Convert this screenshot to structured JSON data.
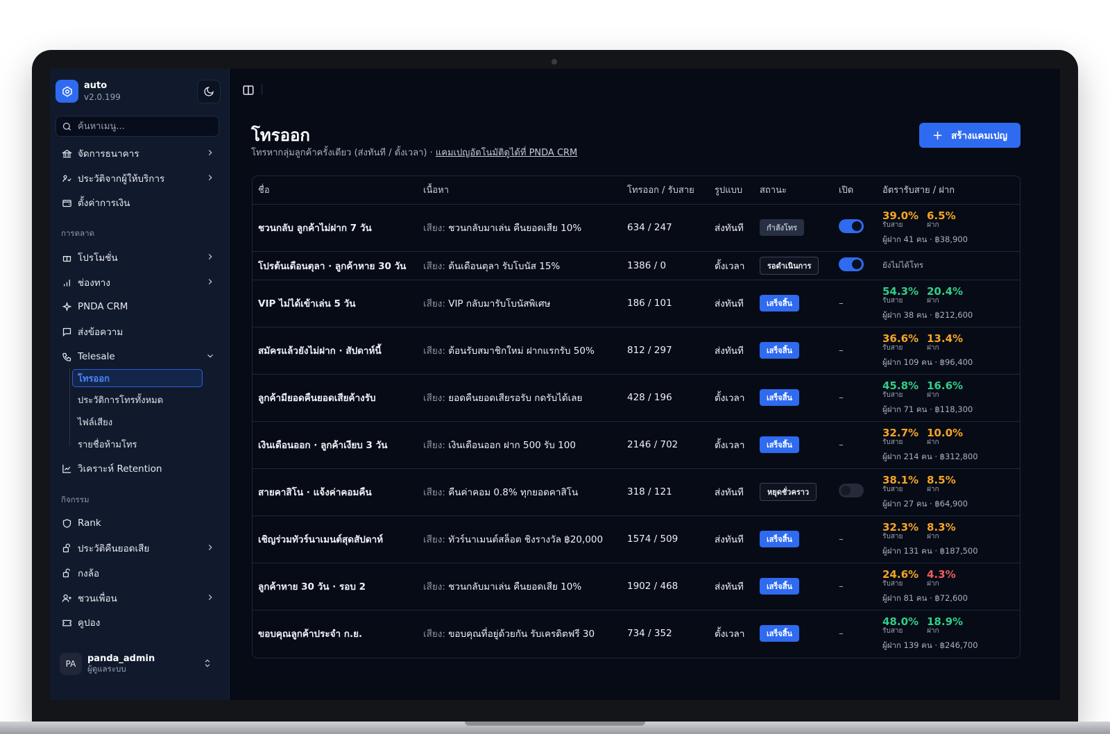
{
  "app": {
    "name": "auto",
    "version": "v2.0.199"
  },
  "search": {
    "placeholder": "ค้นหาเมนู..."
  },
  "sidebar": {
    "top_items": [
      {
        "label": "จัดการธนาคาร",
        "icon": "bank-icon"
      },
      {
        "label": "ประวัติจากผู้ให้บริการ",
        "icon": "provider-icon"
      },
      {
        "label": "ตั้งค่าการเงิน",
        "icon": "wallet-icon"
      }
    ],
    "section_marketing": "การตลาด",
    "marketing_items": [
      {
        "label": "โปรโมชั่น",
        "icon": "gift-icon"
      },
      {
        "label": "ช่องทาง",
        "icon": "bar-chart-icon"
      },
      {
        "label": "PNDA CRM",
        "icon": "sparkle-icon"
      },
      {
        "label": "ส่งข้อความ",
        "icon": "message-icon"
      },
      {
        "label": "Telesale",
        "icon": "phone-icon"
      }
    ],
    "telesale_sub": [
      "โทรออก",
      "ประวัติการโทรทั้งหมด",
      "ไฟล์เสียง",
      "รายชื่อห้ามโทร"
    ],
    "retention": "วิเคราะห์ Retention",
    "section_activity": "กิจกรรม",
    "activity_items": [
      {
        "label": "Rank",
        "icon": "shield-icon"
      },
      {
        "label": "ประวัติคืนยอดเสีย",
        "icon": "refund-icon"
      },
      {
        "label": "กงล้อ",
        "icon": "wheel-icon"
      },
      {
        "label": "ชวนเพื่อน",
        "icon": "user-plus-icon"
      },
      {
        "label": "คูปอง",
        "icon": "ticket-icon"
      }
    ],
    "user": {
      "initials": "PA",
      "name": "panda_admin",
      "role": "ผู้ดูแลระบบ"
    }
  },
  "page": {
    "title": "โทรออก",
    "subtitle": "โทรหากลุ่มลูกค้าครั้งเดียว (ส่งทันที / ตั้งเวลา) ·",
    "subtitle_link": "แคมเปญอัตโนมัติดูได้ที่ PNDA CRM",
    "create_button": "สร้างแคมเปญ"
  },
  "table": {
    "headers": [
      "ชื่อ",
      "เนื้อหา",
      "โทรออก / รับสาย",
      "รูปแบบ",
      "สถานะ",
      "เปิด",
      "อัตรารับสาย / ฝาก"
    ],
    "voice_prefix": "เสียง:",
    "answer_label": "รับสาย",
    "deposit_label": "ฝาก",
    "rows": [
      {
        "name": "ชวนกลับ ลูกค้าไม่ฝาก 7 วัน",
        "content": "ชวนกลับมาเล่น คืนยอดเสีย 10%",
        "calls": "634 / 247",
        "mode": "ส่งทันที",
        "status": "กำลังโทร",
        "status_type": "calling",
        "toggle": "on",
        "answer_rate": "39.0%",
        "deposit_rate": "6.5%",
        "answer_color": "#f5a524",
        "deposit_color": "#f5a524",
        "footer": "ผู้ฝาก 41 คน · ฿38,900"
      },
      {
        "name": "โปรต้นเดือนตุลา · ลูกค้าหาย 30 วัน",
        "content": "ต้นเดือนตุลา รับโบนัส 15%",
        "calls": "1386 / 0",
        "mode": "ตั้งเวลา",
        "status": "รอดำเนินการ",
        "status_type": "pending",
        "toggle": "on",
        "not_called": "ยังไม่ได้โทร"
      },
      {
        "name": "VIP ไม่ได้เข้าเล่น 5 วัน",
        "content": "VIP กลับมารับโบนัสพิเศษ",
        "calls": "186 / 101",
        "mode": "ส่งทันที",
        "status": "เสร็จสิ้น",
        "status_type": "done",
        "toggle": "none",
        "dash": "–",
        "answer_rate": "54.3%",
        "deposit_rate": "20.4%",
        "answer_color": "#2fcf86",
        "deposit_color": "#2fcf86",
        "footer": "ผู้ฝาก 38 คน · ฿212,600"
      },
      {
        "name": "สมัครแล้วยังไม่ฝาก · สัปดาห์นี้",
        "content": "ต้อนรับสมาชิกใหม่ ฝากแรกรับ 50%",
        "calls": "812 / 297",
        "mode": "ส่งทันที",
        "status": "เสร็จสิ้น",
        "status_type": "done",
        "toggle": "none",
        "dash": "–",
        "answer_rate": "36.6%",
        "deposit_rate": "13.4%",
        "answer_color": "#f5a524",
        "deposit_color": "#f5a524",
        "footer": "ผู้ฝาก 109 คน · ฿96,400"
      },
      {
        "name": "ลูกค้ามียอดคืนยอดเสียค้างรับ",
        "content": "ยอดคืนยอดเสียรอรับ กดรับได้เลย",
        "calls": "428 / 196",
        "mode": "ตั้งเวลา",
        "status": "เสร็จสิ้น",
        "status_type": "done",
        "toggle": "none",
        "dash": "–",
        "answer_rate": "45.8%",
        "deposit_rate": "16.6%",
        "answer_color": "#2fcf86",
        "deposit_color": "#2fcf86",
        "footer": "ผู้ฝาก 71 คน · ฿118,300"
      },
      {
        "name": "เงินเดือนออก · ลูกค้าเงียบ 3 วัน",
        "content": "เงินเดือนออก ฝาก 500 รับ 100",
        "calls": "2146 / 702",
        "mode": "ตั้งเวลา",
        "status": "เสร็จสิ้น",
        "status_type": "done",
        "toggle": "none",
        "dash": "–",
        "answer_rate": "32.7%",
        "deposit_rate": "10.0%",
        "answer_color": "#f5a524",
        "deposit_color": "#f5a524",
        "footer": "ผู้ฝาก 214 คน · ฿312,800"
      },
      {
        "name": "สายคาสิโน · แจ้งค่าคอมคืน",
        "content": "คืนค่าคอม 0.8% ทุกยอดคาสิโน",
        "calls": "318 / 121",
        "mode": "ส่งทันที",
        "status": "หยุดชั่วคราว",
        "status_type": "paused",
        "toggle": "off",
        "answer_rate": "38.1%",
        "deposit_rate": "8.5%",
        "answer_color": "#f5a524",
        "deposit_color": "#f5a524",
        "footer": "ผู้ฝาก 27 คน · ฿64,900"
      },
      {
        "name": "เชิญร่วมทัวร์นาเมนต์สุดสัปดาห์",
        "content": "ทัวร์นาเมนต์สล็อต ชิงรางวัล ฿20,000",
        "calls": "1574 / 509",
        "mode": "ส่งทันที",
        "status": "เสร็จสิ้น",
        "status_type": "done",
        "toggle": "none",
        "dash": "–",
        "answer_rate": "32.3%",
        "deposit_rate": "8.3%",
        "answer_color": "#f5a524",
        "deposit_color": "#f5a524",
        "footer": "ผู้ฝาก 131 คน · ฿187,500"
      },
      {
        "name": "ลูกค้าหาย 30 วัน · รอบ 2",
        "content": "ชวนกลับมาเล่น คืนยอดเสีย 10%",
        "calls": "1902 / 468",
        "mode": "ส่งทันที",
        "status": "เสร็จสิ้น",
        "status_type": "done",
        "toggle": "none",
        "dash": "–",
        "answer_rate": "24.6%",
        "deposit_rate": "4.3%",
        "answer_color": "#f5a524",
        "deposit_color": "#f25c5c",
        "footer": "ผู้ฝาก 81 คน · ฿72,600"
      },
      {
        "name": "ขอบคุณลูกค้าประจำ ก.ย.",
        "content": "ขอบคุณที่อยู่ด้วยกัน รับเครดิตฟรี 30",
        "calls": "734 / 352",
        "mode": "ตั้งเวลา",
        "status": "เสร็จสิ้น",
        "status_type": "done",
        "toggle": "none",
        "dash": "–",
        "answer_rate": "48.0%",
        "deposit_rate": "18.9%",
        "answer_color": "#2fcf86",
        "deposit_color": "#2fcf86",
        "footer": "ผู้ฝาก 139 คน · ฿246,700"
      }
    ]
  }
}
